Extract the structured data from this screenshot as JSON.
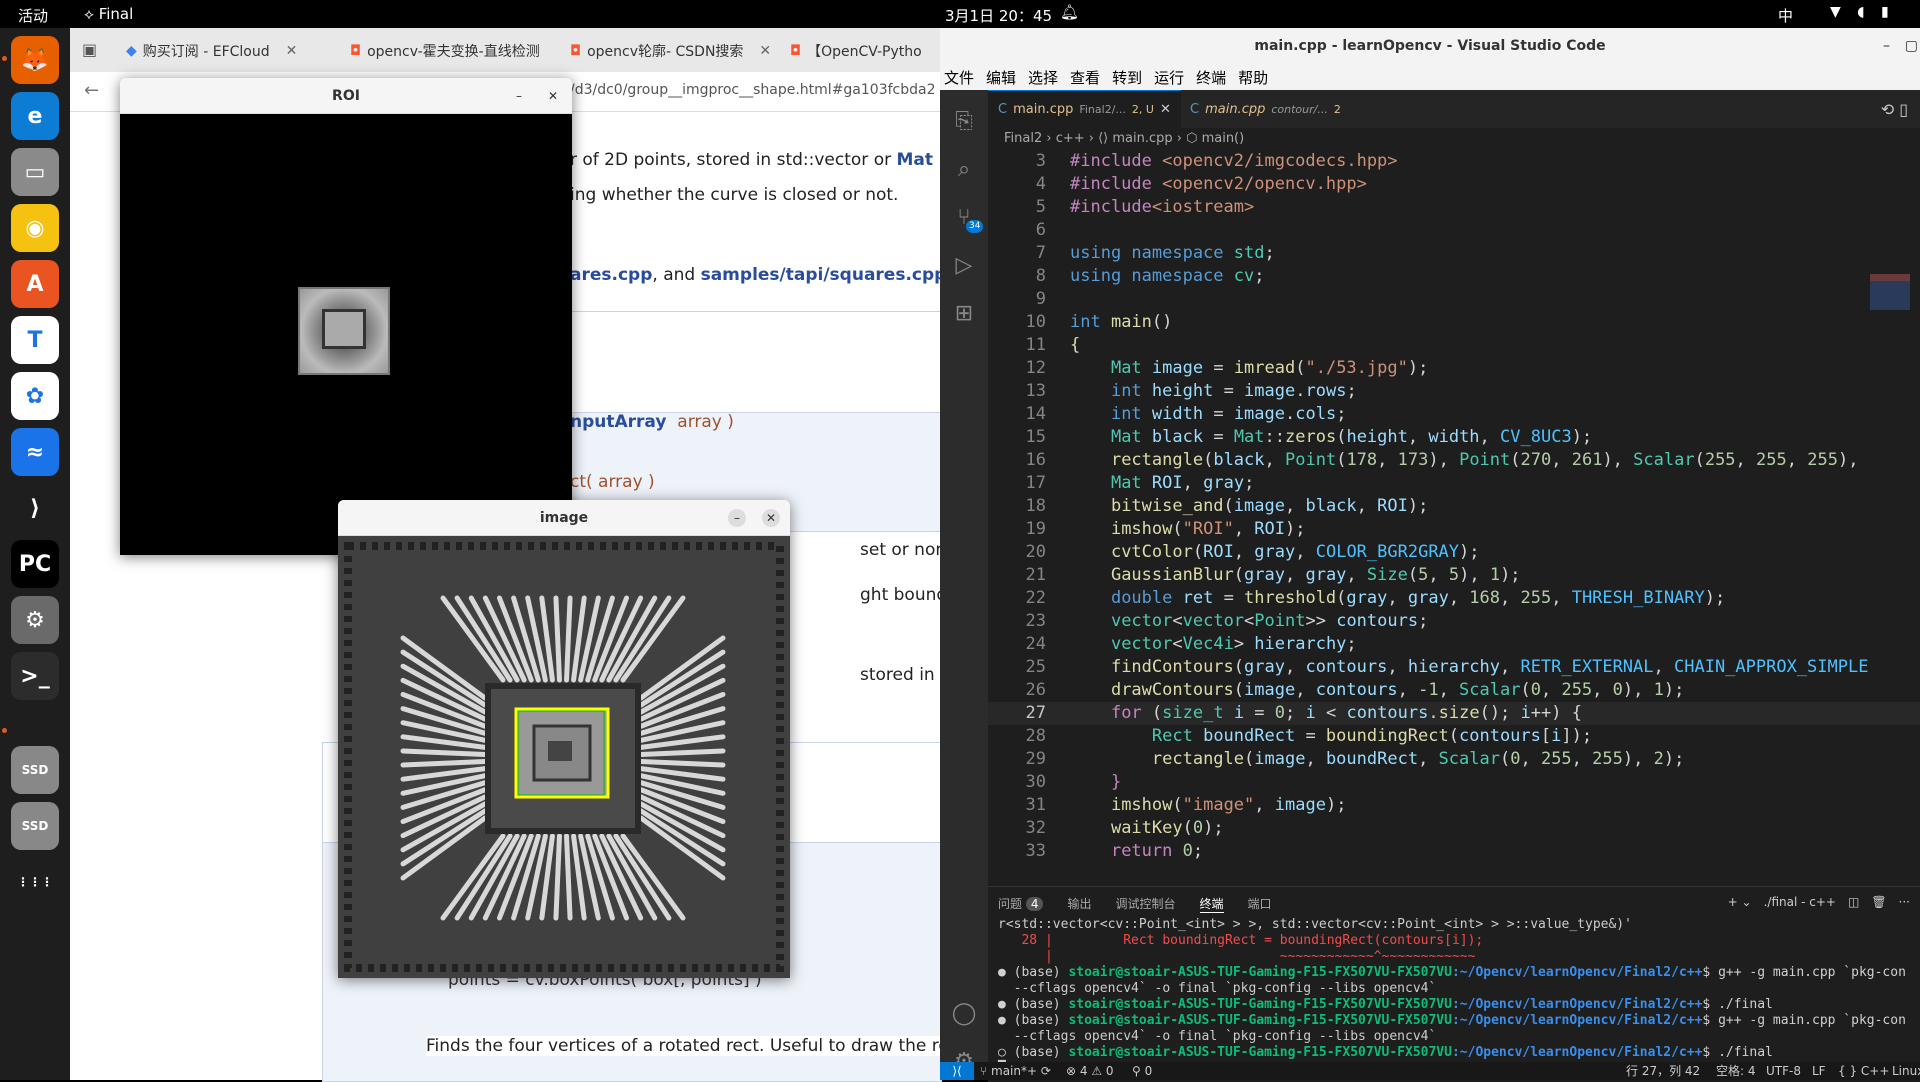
{
  "topbar": {
    "activities": "活动",
    "app": "Final",
    "clock": "3月1日 20：45",
    "input_lang": "中",
    "tray": "▼ ◖ ▮"
  },
  "dock": {
    "items": [
      {
        "name": "firefox-icon",
        "glyph": "🦊",
        "bg": "#e66000"
      },
      {
        "name": "edge-icon",
        "glyph": "e",
        "bg": "#0c7cd5"
      },
      {
        "name": "files-icon",
        "glyph": "▭",
        "bg": "#8a8a8a"
      },
      {
        "name": "rhythmbox-icon",
        "glyph": "◉",
        "bg": "#f5c211"
      },
      {
        "name": "app-center-icon",
        "glyph": "A",
        "bg": "#e95420"
      },
      {
        "name": "typora-icon",
        "glyph": "T",
        "bg": "#ffffff"
      },
      {
        "name": "baidu-netdisk-icon",
        "glyph": "✿",
        "bg": "#ffffff"
      },
      {
        "name": "feishu-icon",
        "glyph": "≈",
        "bg": "#1a73e8"
      },
      {
        "name": "vscode-icon",
        "glyph": "⟩",
        "bg": "#1e1e1e"
      },
      {
        "name": "pycharm-icon",
        "glyph": "PC",
        "bg": "#000000"
      },
      {
        "name": "settings-icon",
        "glyph": "⚙",
        "bg": "#6a6a6a"
      },
      {
        "name": "terminal-icon",
        "glyph": ">_",
        "bg": "#2c2c2c"
      },
      {
        "name": "ssd1-icon",
        "glyph": "SSD",
        "bg": "#888888"
      },
      {
        "name": "ssd2-icon",
        "glyph": "SSD",
        "bg": "#888888"
      },
      {
        "name": "show-apps-icon",
        "glyph": "⋮⋮⋮",
        "bg": "#1e1e1e"
      }
    ]
  },
  "browser": {
    "tabs": [
      "购买订阅 - EFCloud",
      "opencv-霍夫变换-直线检测",
      "opencv轮廓- CSDN搜索",
      "【OpenCV-Pytho"
    ],
    "url": "/d3/dc0/group__imgproc__shape.html#ga103fcbda2",
    "doc": {
      "l1a": "r of 2D points, stored in std::vector or ",
      "l1b": "Mat",
      "l2": "ing whether the curve is closed or not.",
      "l3a": "ares.cpp",
      "l3b": ", and ",
      "l3c": "samples/tapi/squares.cpp",
      "l4a": "nputArray",
      "l4b": "array )",
      "l5": "ct( array )",
      "l6": "set or non-zero pi",
      "l7": "ght bounding recta",
      "l8": "stored in std::vecto",
      "l9": "points = cv.boxPoints( box[, points] )",
      "l10": "Finds the four vertices of a rotated rect. Useful to draw the rotated recta"
    }
  },
  "roi_window": {
    "title": "ROI"
  },
  "image_window": {
    "title": "image"
  },
  "vscode": {
    "title": "main.cpp - learnOpencv - Visual Studio Code",
    "menu": [
      "文件",
      "编辑",
      "选择",
      "查看",
      "转到",
      "运行",
      "终端",
      "帮助"
    ],
    "tabs": [
      {
        "label": "main.cpp",
        "path": "Final2/...",
        "badge": "2, U"
      },
      {
        "label": "main.cpp",
        "path": "contour/...",
        "badge": "2"
      }
    ],
    "breadcrumb": "Final2 › c++ › ⟨⟩ main.cpp › ⬡ main()",
    "scm_badge": "34",
    "panel_tabs": [
      "问题",
      "输出",
      "调试控制台",
      "终端",
      "端口"
    ],
    "problems_count": "4",
    "terminal_profile": "./final - c++",
    "terminal": [
      "r<std::vector<cv::Point_<int> > >, std::vector<cv::Point_<int> > >::value_type&)'",
      "   28 |         Rect boundingRect = boundingRect(contours[i]);",
      "      |                             ~~~~~~~~~~~~^~~~~~~~~~~~~",
      "● (base) stoair@stoair-ASUS-TUF-Gaming-F15-FX507VU-FX507VU:~/Opencv/learnOpencv/Final2/c++$ g++ -g main.cpp `pkg-con",
      "  --cflags opencv4` -o final `pkg-config --libs opencv4`",
      "● (base) stoair@stoair-ASUS-TUF-Gaming-F15-FX507VU-FX507VU:~/Opencv/learnOpencv/Final2/c++$ ./final",
      "● (base) stoair@stoair-ASUS-TUF-Gaming-F15-FX507VU-FX507VU:~/Opencv/learnOpencv/Final2/c++$ g++ -g main.cpp `pkg-con",
      "  --cflags opencv4` -o final `pkg-config --libs opencv4`",
      "○ (base) stoair@stoair-ASUS-TUF-Gaming-F15-FX507VU-FX507VU:~/Opencv/learnOpencv/Final2/c++$ ./final",
      "█"
    ],
    "status": {
      "branch": "main*+",
      "errors": "⊗ 4 ⚠ 0",
      "ports": "⚲ 0",
      "pos": "行 27，列 42",
      "spaces": "空格: 4",
      "enc": "UTF-8",
      "eol": "LF",
      "lang": "{ } C++",
      "os": "Linux"
    }
  }
}
